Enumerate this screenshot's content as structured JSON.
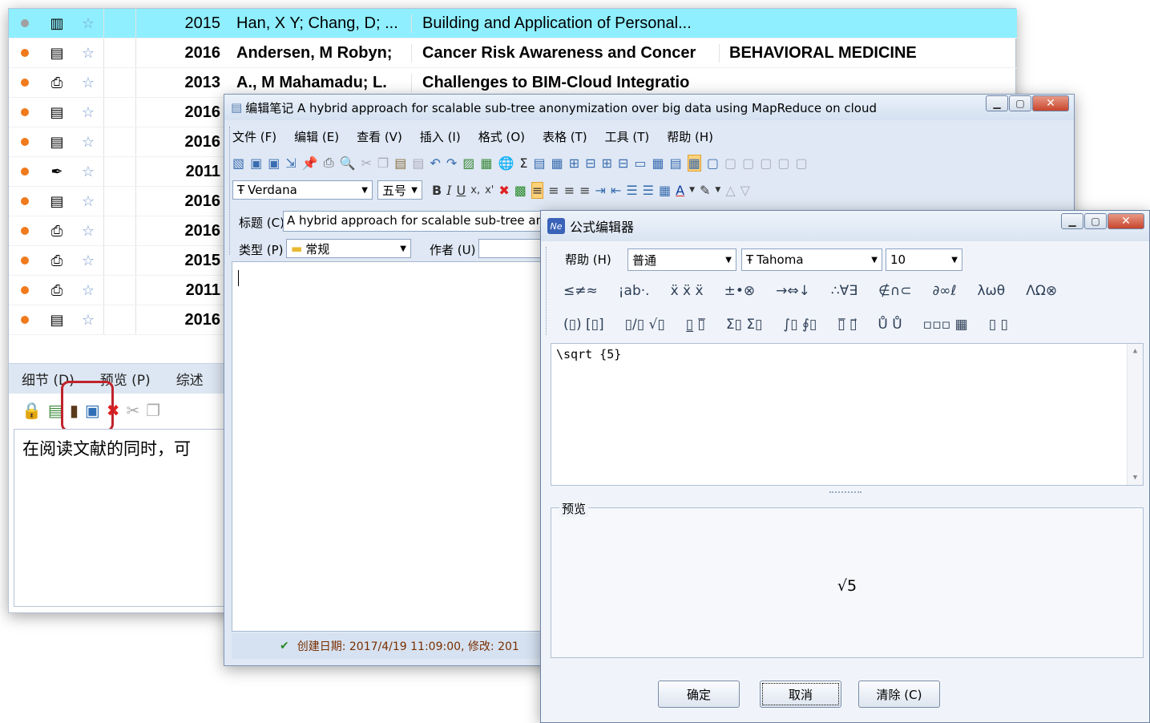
{
  "list": {
    "rows": [
      {
        "dot": "#a0a0a0",
        "type": "book-icon",
        "year": "2015",
        "authors": "Han, X Y; Chang, D; ...",
        "title": "Building and Application of Personal...",
        "journal": "",
        "selected": true,
        "bold": false
      },
      {
        "dot": "#f07a1c",
        "type": "document-icon",
        "year": "2016",
        "authors": "Andersen, M Robyn;",
        "title": "Cancer Risk Awareness and Concer",
        "journal": "BEHAVIORAL MEDICINE",
        "selected": false,
        "bold": true
      },
      {
        "dot": "#f07a1c",
        "type": "printer-icon",
        "year": "2013",
        "authors": "A., M Mahamadu; L.",
        "title": "Challenges to BIM-Cloud Integratio",
        "journal": "",
        "selected": false,
        "bold": true
      },
      {
        "dot": "#f07a1c",
        "type": "document-icon",
        "year": "2016",
        "authors": "",
        "title": "",
        "journal": "",
        "selected": false,
        "bold": true
      },
      {
        "dot": "#f07a1c",
        "type": "document-icon",
        "year": "2016",
        "authors": "",
        "title": "",
        "journal": "",
        "selected": false,
        "bold": true
      },
      {
        "dot": "#f07a1c",
        "type": "pen-icon",
        "year": "2011",
        "authors": "",
        "title": "",
        "journal": "",
        "selected": false,
        "bold": true
      },
      {
        "dot": "#f07a1c",
        "type": "document-icon",
        "year": "2016",
        "authors": "",
        "title": "",
        "journal": "",
        "selected": false,
        "bold": true
      },
      {
        "dot": "#f07a1c",
        "type": "printer-icon",
        "year": "2016",
        "authors": "",
        "title": "",
        "journal": "",
        "selected": false,
        "bold": true
      },
      {
        "dot": "#f07a1c",
        "type": "printer-icon",
        "year": "2015",
        "authors": "",
        "title": "",
        "journal": "",
        "selected": false,
        "bold": true
      },
      {
        "dot": "#f07a1c",
        "type": "printer-icon",
        "year": "2011",
        "authors": "",
        "title": "",
        "journal": "",
        "selected": false,
        "bold": true
      },
      {
        "dot": "#f07a1c",
        "type": "document-icon",
        "year": "2016",
        "authors": "",
        "title": "",
        "journal": "",
        "selected": false,
        "bold": true
      }
    ],
    "tabs": [
      "细节 (D)",
      "预览 (P)",
      "综述"
    ],
    "note_text": "在阅读文献的同时，可"
  },
  "editor": {
    "title": "编辑笔记 A hybrid approach for scalable sub-tree anonymization over big data using MapReduce on cloud",
    "menu": [
      "文件 (F)",
      "编辑 (E)",
      "查看 (V)",
      "插入 (I)",
      "格式 (O)",
      "表格 (T)",
      "工具 (T)",
      "帮助 (H)"
    ],
    "font": "Verdana",
    "size": "五号",
    "fmt_bold": "B",
    "fmt_italic": "I",
    "fmt_underline": "U",
    "fmt_sub": "x,",
    "fmt_sup": "x'",
    "title_label": "标题 (C)",
    "title_value": "A hybrid approach for scalable sub-tree and",
    "type_label": "类型 (P)",
    "type_value": "常规",
    "author_label": "作者 (U)",
    "status": "创建日期: 2017/4/19 11:09:00, 修改: 201"
  },
  "formula": {
    "title": "公式编辑器",
    "help_label": "帮助 (H)",
    "style": "普通",
    "font": "Tahoma",
    "size": "10",
    "symbols_row1": [
      "≤≠≈",
      "¡ab·.",
      "ẍ ẍ ẍ",
      "±•⊗",
      "→⇔↓",
      "∴∀∃",
      "∉∩⊂",
      "∂∞ℓ",
      "λωθ",
      "ΛΩ⊗"
    ],
    "symbols_row2": [
      "(▯) [▯]",
      "▯/▯ √▯",
      "▯̲ ▯̅",
      "Σ▯ Σ▯",
      "∫▯ ∮▯",
      "▯̅ ▯⃗",
      "Ů Ů",
      "▫▫▫ ▦",
      "▯ ▯"
    ],
    "source": "\\sqrt {5}",
    "preview_label": "预览",
    "preview": "√5",
    "ok": "确定",
    "cancel": "取消",
    "clear": "清除 (C)"
  }
}
